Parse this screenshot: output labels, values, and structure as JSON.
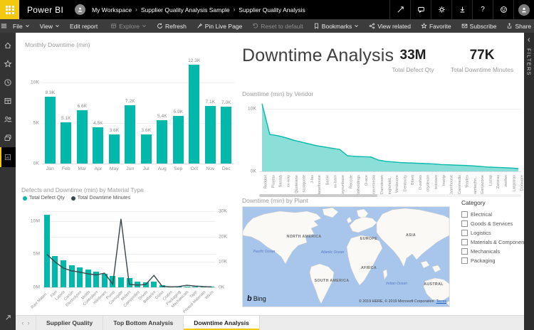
{
  "colors": {
    "accent": "#F2C811",
    "teal": "#01B8AA",
    "line_dark": "#374649"
  },
  "header": {
    "brand": "Power BI",
    "breadcrumb": [
      "My Workspace",
      "Supplier Quality Analysis Sample",
      "Supplier Quality Analysis"
    ],
    "help": "?"
  },
  "menubar": {
    "file": "File",
    "view": "View",
    "edit_report": "Edit report",
    "explore": "Explore",
    "refresh": "Refresh",
    "pin_live_page": "Pin Live Page",
    "reset": "Reset to default",
    "bookmarks": "Bookmarks",
    "view_related": "View related",
    "favorite": "Favorite",
    "subscribe": "Subscribe",
    "share": "Share"
  },
  "title_block": {
    "title": "Downtime Analysis",
    "kpis": [
      {
        "value": "33M",
        "label": "Total Defect Qty"
      },
      {
        "value": "77K",
        "label": "Total Downtime Minutes"
      }
    ]
  },
  "chart_data": [
    {
      "id": "monthly_downtime",
      "type": "bar",
      "title": "Monthly Downtime (min)",
      "categories": [
        "Jan",
        "Feb",
        "Mar",
        "Apr",
        "May",
        "Jun",
        "Jul",
        "Aug",
        "Sep",
        "Oct",
        "Nov",
        "Dec"
      ],
      "values": [
        8300,
        5100,
        6600,
        4500,
        3600,
        7200,
        3600,
        5400,
        5900,
        12300,
        7100,
        7000
      ],
      "labels": [
        "8.3K",
        "5.1K",
        "6.6K",
        "4.5K",
        "3.6K",
        "7.2K",
        "3.6K",
        "5.4K",
        "5.9K",
        "12.3K",
        "7.1K",
        "7.0K"
      ],
      "yticks": [
        {
          "label": "0K",
          "value": 0
        },
        {
          "label": "5K",
          "value": 5000
        },
        {
          "label": "10K",
          "value": 10000
        }
      ],
      "ymax": 13000,
      "bar_color": "#01B8AA",
      "grid": true,
      "legend": "none"
    },
    {
      "id": "vendor_downtime",
      "type": "area",
      "title": "Downtime (min) by Vendor",
      "categories": [
        "Reddoit",
        "Pluytax",
        "Sanlab",
        "xx-way",
        "Quotelane",
        "scotquote",
        "J-lax",
        "Planethouse",
        "Sanin",
        "xx-bam",
        "Keyrunbase",
        "Recode",
        "Solholdings",
        "O-ace",
        "Gravemedia",
        "Damdexon",
        "Singlehold...",
        "Ventocore",
        "Dentocity",
        "Blueit",
        "D-zohex",
        "citydexon",
        "ontotam",
        "Instrip",
        "Zaamhouse",
        "Caremedix",
        "Yearlex",
        "Bamtechn...",
        "Ganjazone",
        "Lazap",
        "Zentrax",
        "zoofan",
        "Latgotrax",
        "Donware"
      ],
      "values": [
        10800,
        5900,
        5700,
        5400,
        5000,
        4700,
        4400,
        4100,
        3900,
        3700,
        3500,
        2500,
        2400,
        2350,
        2300,
        1800,
        1600,
        1500,
        1400,
        1350,
        1300,
        1250,
        1200,
        1100,
        1050,
        1000,
        950,
        900,
        800,
        700,
        650,
        600,
        550,
        450
      ],
      "yticks": [
        {
          "label": "0K",
          "value": 0
        },
        {
          "label": "10K",
          "value": 10000
        }
      ],
      "ymax": 11000,
      "area_color": "#01B8AA",
      "grid": true,
      "legend": "none",
      "has_scrollbar": true
    },
    {
      "id": "material_combo",
      "type": "bar+line",
      "title": "Defects and Downtime (min) by Material Type",
      "categories": [
        "Raw Materi...",
        "Film",
        "Labels",
        "Carton",
        "Electrolytes",
        "Molds",
        "Controllers",
        "Hardware",
        "Pump",
        "Corrugate",
        "Motors",
        "Composites",
        "Drives",
        "Batteries",
        "Glass",
        "Crates",
        "Packaging",
        "Mechanicals",
        "Tape",
        "Printed Materials",
        "Wires"
      ],
      "series": [
        {
          "name": "Total Defect Qty",
          "type": "bar",
          "axis": "left",
          "color": "#01B8AA",
          "values": [
            11000000,
            4700000,
            4100000,
            3300000,
            3000000,
            2700000,
            2400000,
            2000000,
            1700000,
            1500000,
            1450000,
            900000,
            800000,
            900000,
            350000,
            80000,
            80000,
            150000,
            80000,
            50000,
            40000
          ]
        },
        {
          "name": "Total Downtime Minutes",
          "type": "line",
          "axis": "right",
          "color": "#374649",
          "values": [
            13000,
            10000,
            7600,
            6500,
            6000,
            5300,
            4900,
            5600,
            1200,
            27000,
            1200,
            900,
            1100,
            4700,
            400,
            200,
            300,
            800,
            500,
            300,
            200
          ]
        }
      ],
      "left_yticks": [
        {
          "label": "0M",
          "value": 0
        },
        {
          "label": "5M",
          "value": 5000000
        },
        {
          "label": "10M",
          "value": 10000000
        }
      ],
      "right_yticks": [
        {
          "label": "0K",
          "value": 0
        },
        {
          "label": "10K",
          "value": 10000
        },
        {
          "label": "20K",
          "value": 20000
        },
        {
          "label": "30K",
          "value": 30000
        }
      ],
      "left_ymax": 11500000,
      "right_ymax": 30000,
      "legend_position": "top"
    },
    {
      "id": "plant_map",
      "type": "map",
      "title": "Downtime (min) by Plant",
      "region_labels": [
        "NORTH AMERICA",
        "EUROPE",
        "ASIA",
        "AFRICA",
        "SOUTH AMERICA",
        "AUSTRAL"
      ],
      "ocean_labels": [
        "Pacific Ocean",
        "Atlantic Ocean",
        "Indian Ocean"
      ],
      "logo": "Bing",
      "attribution": "© 2019 HERE, © 2019 Microsoft Corporation",
      "terms": "Terms"
    }
  ],
  "slicer": {
    "title": "Category",
    "options": [
      "Electrical",
      "Goods & Services",
      "Logistics",
      "Materials & Components",
      "Mechanicals",
      "Packaging"
    ],
    "checked": [
      false,
      false,
      false,
      false,
      false,
      false
    ]
  },
  "tabs": {
    "items": [
      "Supplier Quality",
      "Top Bottom Analysis",
      "Downtime Analysis"
    ],
    "active": "Downtime Analysis"
  },
  "filters_panel": {
    "label": "FILTERS"
  }
}
